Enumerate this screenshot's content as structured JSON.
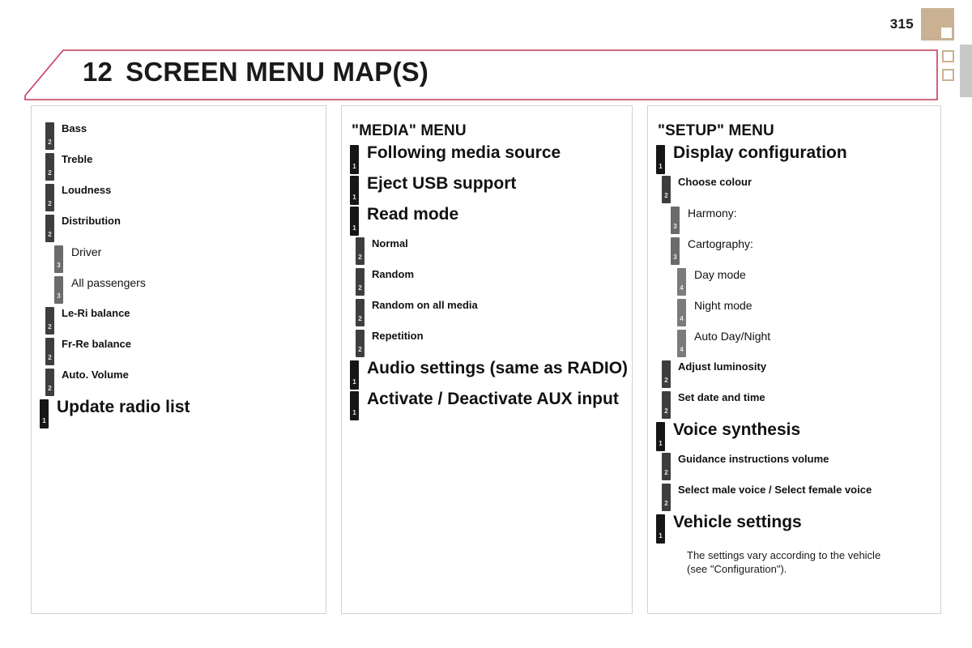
{
  "page": {
    "number": "315",
    "chapter_number": "12",
    "chapter_title": "SCREEN MENU MAP(S)",
    "accent_color": "#c8385a",
    "corner_block_color": "#c9b192"
  },
  "columns": [
    {
      "title": "",
      "entries": [
        {
          "level": 2,
          "label": "Bass"
        },
        {
          "level": 2,
          "label": "Treble"
        },
        {
          "level": 2,
          "label": "Loudness"
        },
        {
          "level": 2,
          "label": "Distribution"
        },
        {
          "level": 3,
          "label": "Driver"
        },
        {
          "level": 3,
          "label": "All passengers"
        },
        {
          "level": 2,
          "label": "Le-Ri balance"
        },
        {
          "level": 2,
          "label": "Fr-Re balance"
        },
        {
          "level": 2,
          "label": "Auto. Volume"
        },
        {
          "level": 1,
          "label": "Update radio list"
        }
      ]
    },
    {
      "title": "\"MEDIA\" MENU",
      "entries": [
        {
          "level": 1,
          "label": "Following media source"
        },
        {
          "level": 1,
          "label": "Eject USB support"
        },
        {
          "level": 1,
          "label": "Read mode"
        },
        {
          "level": 2,
          "label": "Normal"
        },
        {
          "level": 2,
          "label": "Random"
        },
        {
          "level": 2,
          "label": "Random on all media"
        },
        {
          "level": 2,
          "label": "Repetition"
        },
        {
          "level": 1,
          "label": "Audio settings (same as RADIO)"
        },
        {
          "level": 1,
          "label": "Activate / Deactivate AUX input"
        }
      ]
    },
    {
      "title": "\"SETUP\" MENU",
      "entries": [
        {
          "level": 1,
          "label": "Display configuration"
        },
        {
          "level": 2,
          "label": "Choose colour"
        },
        {
          "level": 3,
          "label": "Harmony:"
        },
        {
          "level": 3,
          "label": "Cartography:"
        },
        {
          "level": 4,
          "label": "Day mode"
        },
        {
          "level": 4,
          "label": "Night mode"
        },
        {
          "level": 4,
          "label": "Auto Day/Night"
        },
        {
          "level": 2,
          "label": "Adjust luminosity"
        },
        {
          "level": 2,
          "label": "Set date and time"
        },
        {
          "level": 1,
          "label": "Voice synthesis"
        },
        {
          "level": 2,
          "label": "Guidance instructions volume"
        },
        {
          "level": 2,
          "label": "Select male voice / Select female voice"
        },
        {
          "level": 1,
          "label": "Vehicle settings"
        },
        {
          "level": 0,
          "label": "The settings vary according to the vehicle\n(see \"Configuration\")."
        }
      ]
    }
  ]
}
